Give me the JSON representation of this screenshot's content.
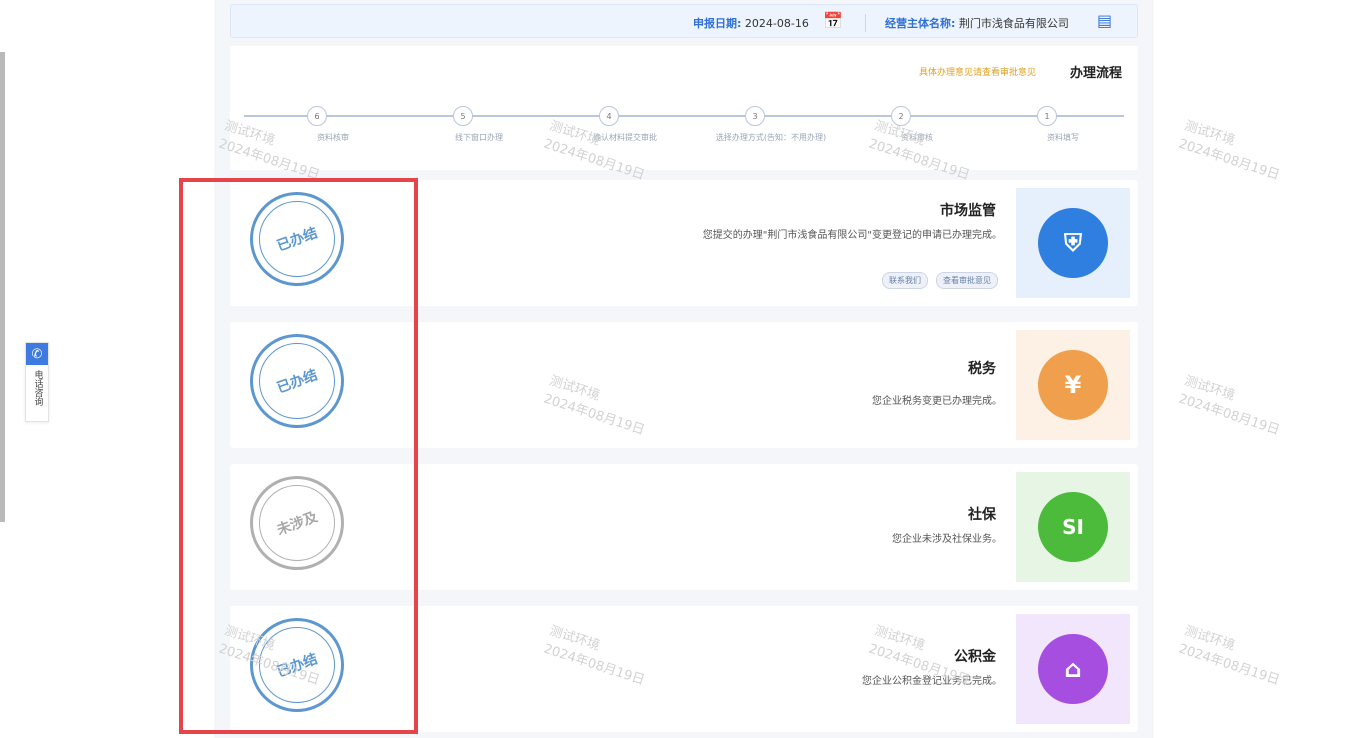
{
  "sidebar_widget": {
    "label": "电话咨询"
  },
  "header": {
    "entity_label": "经营主体名称:",
    "entity_value": "荆门市浅食品有限公司",
    "date_label": "申报日期:",
    "date_value": "2024-08-16"
  },
  "process": {
    "title": "办理流程",
    "hint": "具体办理意见请查看审批意见",
    "steps": [
      {
        "num": "1",
        "label": "资料填写"
      },
      {
        "num": "2",
        "label": "资料审核"
      },
      {
        "num": "3",
        "label": "选择办理方式(告知：不用办理)"
      },
      {
        "num": "4",
        "label": "确认材料提交审批"
      },
      {
        "num": "5",
        "label": "线下窗口办理"
      },
      {
        "num": "6",
        "label": "资料核审"
      }
    ]
  },
  "services": [
    {
      "title": "市场监管",
      "desc": "您提交的办理\"荆门市浅食品有限公司\"变更登记的申请已办理完成。",
      "buttons": [
        "查看审批意见",
        "联系我们"
      ],
      "stamp": "已办结",
      "icon": "shield-user-icon",
      "color": "#2f7fe0"
    },
    {
      "title": "税务",
      "desc": "您企业税务变更已办理完成。",
      "buttons": [],
      "stamp": "已办结",
      "icon": "yuan-hand-icon",
      "color": "#f0a04d"
    },
    {
      "title": "社保",
      "desc": "您企业未涉及社保业务。",
      "buttons": [],
      "stamp": "未涉及",
      "icon": "si-icon",
      "color": "#4cbb3c"
    },
    {
      "title": "公积金",
      "desc": "您企业公积金登记业务已完成。",
      "buttons": [],
      "stamp": "已办结",
      "icon": "yuan-house-icon",
      "color": "#a54ee0"
    }
  ],
  "watermark": {
    "line1": "测试环境",
    "line2": "2024年08月19日"
  }
}
